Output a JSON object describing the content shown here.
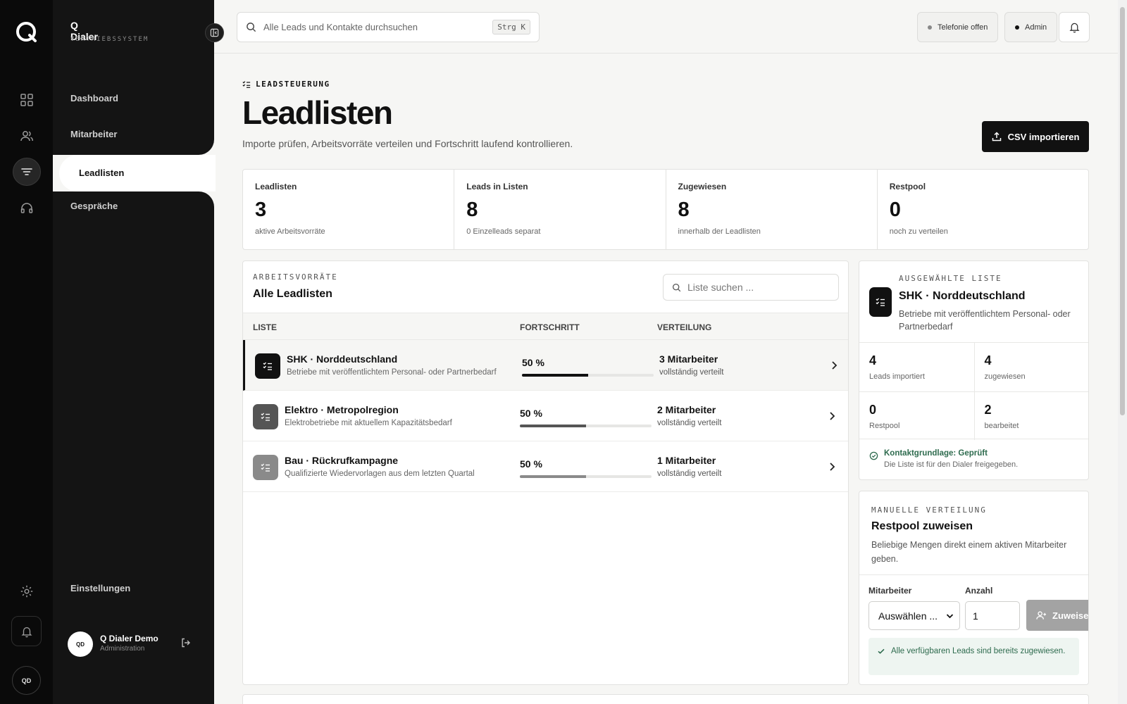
{
  "app": {
    "name": "Q Dialer",
    "subtitle": "VERTRIEBSSYSTEM"
  },
  "nav": {
    "items": [
      {
        "label": "Dashboard",
        "icon": "grid-icon"
      },
      {
        "label": "Mitarbeiter",
        "icon": "users-icon"
      },
      {
        "label": "Leadlisten",
        "icon": "filter-icon",
        "active": true
      },
      {
        "label": "Gespräche",
        "icon": "headphones-icon"
      }
    ],
    "settings_label": "Einstellungen"
  },
  "user": {
    "initials": "QD",
    "name": "Q Dialer Demo",
    "role": "Administration"
  },
  "topbar": {
    "search_placeholder": "Alle Leads und Kontakte durchsuchen",
    "shortcut": "Strg K",
    "telephony_label": "Telefonie offen",
    "role_label": "Admin"
  },
  "header": {
    "eyebrow": "LEADSTEUERUNG",
    "title": "Leadlisten",
    "subtitle": "Importe prüfen, Arbeitsvorräte verteilen und Fortschritt laufend kontrollieren.",
    "import_button": "CSV importieren"
  },
  "stats": [
    {
      "label": "Leadlisten",
      "value": "3",
      "sub": "aktive Arbeitsvorräte"
    },
    {
      "label": "Leads in Listen",
      "value": "8",
      "sub": "0 Einzelleads separat"
    },
    {
      "label": "Zugewiesen",
      "value": "8",
      "sub": "innerhalb der Leadlisten"
    },
    {
      "label": "Restpool",
      "value": "0",
      "sub": "noch zu verteilen"
    }
  ],
  "lists_panel": {
    "eyebrow": "ARBEITSVORRÄTE",
    "title": "Alle Leadlisten",
    "search_placeholder": "Liste suchen ...",
    "columns": [
      "LISTE",
      "FORTSCHRITT",
      "VERTEILUNG"
    ],
    "rows": [
      {
        "name": "SHK · Norddeutschland",
        "desc": "Betriebe mit veröffentlichtem Personal- oder Partnerbedarf",
        "progress_label": "50 %",
        "progress": 0.5,
        "distribution": "3 Mitarbeiter",
        "distribution_sub": "vollständig verteilt",
        "color": "#111111",
        "selected": true
      },
      {
        "name": "Elektro · Metropolregion",
        "desc": "Elektrobetriebe mit aktuellem Kapazitätsbedarf",
        "progress_label": "50 %",
        "progress": 0.5,
        "distribution": "2 Mitarbeiter",
        "distribution_sub": "vollständig verteilt",
        "color": "#555555",
        "selected": false
      },
      {
        "name": "Bau · Rückrufkampagne",
        "desc": "Qualifizierte Wiedervorlagen aus dem letzten Quartal",
        "progress_label": "50 %",
        "progress": 0.5,
        "distribution": "1 Mitarbeiter",
        "distribution_sub": "vollständig verteilt",
        "color": "#8a8a8a",
        "selected": false
      }
    ]
  },
  "selected": {
    "eyebrow": "AUSGEWÄHLTE LISTE",
    "title": "SHK · Norddeutschland",
    "desc": "Betriebe mit veröffentlichtem Personal- oder Partnerbedarf",
    "kpis": [
      {
        "value": "4",
        "label": "Leads importiert"
      },
      {
        "value": "4",
        "label": "zugewiesen"
      },
      {
        "value": "0",
        "label": "Restpool"
      },
      {
        "value": "2",
        "label": "bearbeitet"
      }
    ],
    "check_title": "Kontaktgrundlage: Geprüft",
    "check_sub": "Die Liste ist für den Dialer freigegeben."
  },
  "manual": {
    "eyebrow": "MANUELLE VERTEILUNG",
    "title": "Restpool zuweisen",
    "desc": "Beliebige Mengen direkt einem aktiven Mitarbeiter geben.",
    "employee_label": "Mitarbeiter",
    "employee_value": "Auswählen ...",
    "count_label": "Anzahl",
    "count_value": "1",
    "assign_button": "Zuweisen",
    "info": "Alle verfügbaren Leads sind bereits zugewiesen."
  },
  "colors": {
    "accent": "#111111",
    "nav_bg": "#141414",
    "rail_bg": "#0a0a0a",
    "success": "#2e6b4e",
    "page_bg": "#f6f6f4"
  }
}
